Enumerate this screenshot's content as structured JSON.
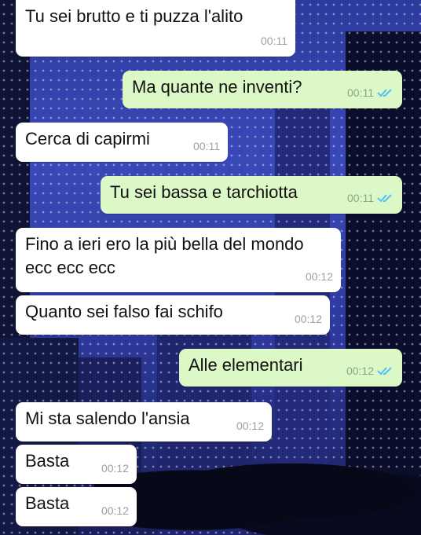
{
  "messages": [
    {
      "dir": "in",
      "text": "Tu sei brutto e ti puzza l'alito",
      "time": "00:11"
    },
    {
      "dir": "out",
      "text": "Ma quante ne inventi?",
      "time": "00:11",
      "status": "read"
    },
    {
      "dir": "in",
      "text": "Cerca di capirmi",
      "time": "00:11"
    },
    {
      "dir": "out",
      "text": "Tu sei bassa e tarchiotta",
      "time": "00:11",
      "status": "read"
    },
    {
      "dir": "in",
      "text_line1": "Fino a ieri ero la più bella del mondo",
      "text_line2": "ecc ecc ecc",
      "time": "00:12"
    },
    {
      "dir": "in",
      "text": "Quanto sei falso fai schifo",
      "time": "00:12"
    },
    {
      "dir": "out",
      "text": "Alle elementari",
      "time": "00:12",
      "status": "read"
    },
    {
      "dir": "in",
      "text": "Mi sta salendo l'ansia",
      "time": "00:12"
    },
    {
      "dir": "in",
      "text": "Basta",
      "time": "00:12"
    },
    {
      "dir": "in",
      "text": "Basta",
      "time": "00:12"
    }
  ],
  "colors": {
    "incoming": "#ffffff",
    "outgoing": "#dcf8c6",
    "read_ticks": "#4fc3f7"
  },
  "icons": {
    "read_receipt": "double-check-icon",
    "wallpaper": "city-night-wallpaper"
  }
}
